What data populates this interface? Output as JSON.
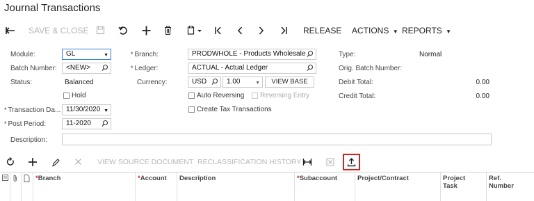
{
  "page": {
    "title": "Journal Transactions"
  },
  "toolbar": {
    "save_close": "SAVE & CLOSE",
    "release": "RELEASE",
    "actions": "ACTIONS",
    "reports": "REPORTS"
  },
  "form": {
    "module_label": "Module:",
    "module_value": "GL",
    "batch_number_label": "Batch Number:",
    "batch_number_value": "<NEW>",
    "status_label": "Status:",
    "status_value": "Balanced",
    "hold_label": "Hold",
    "transaction_date_label": "Transaction Da...",
    "transaction_date_value": "11/30/2020",
    "post_period_label": "Post Period:",
    "post_period_value": "11-2020",
    "description_label": "Description:",
    "description_value": "",
    "branch_label": "Branch:",
    "branch_value": "PRODWHOLE - Products Wholesale",
    "ledger_label": "Ledger:",
    "ledger_value": "ACTUAL - Actual Ledger",
    "currency_label": "Currency:",
    "currency_code": "USD",
    "currency_rate": "1.00",
    "view_base": "VIEW BASE",
    "auto_reversing": "Auto Reversing",
    "reversing_entry": "Reversing Entry",
    "create_tax": "Create Tax Transactions",
    "type_label": "Type:",
    "type_value": "Normal",
    "orig_batch_label": "Orig. Batch Number:",
    "debit_total_label": "Debit Total:",
    "debit_total_value": "0.00",
    "credit_total_label": "Credit Total:",
    "credit_total_value": "0.00",
    "required_mark": "*"
  },
  "grid_toolbar": {
    "view_source": "VIEW SOURCE DOCUMENT",
    "reclass_history": "RECLASSIFICATION HISTORY"
  },
  "grid": {
    "columns": [
      {
        "label": "Branch",
        "required": true
      },
      {
        "label": "Account",
        "required": true
      },
      {
        "label": "Description",
        "required": false
      },
      {
        "label": "Subaccount",
        "required": true
      },
      {
        "label": "Project/Contract",
        "required": false
      },
      {
        "label": "Project Task",
        "required": false
      },
      {
        "label": "Ref. Number",
        "required": false
      }
    ]
  },
  "colors": {
    "highlight": "#e21b1b",
    "focus": "#2f7fd6"
  }
}
